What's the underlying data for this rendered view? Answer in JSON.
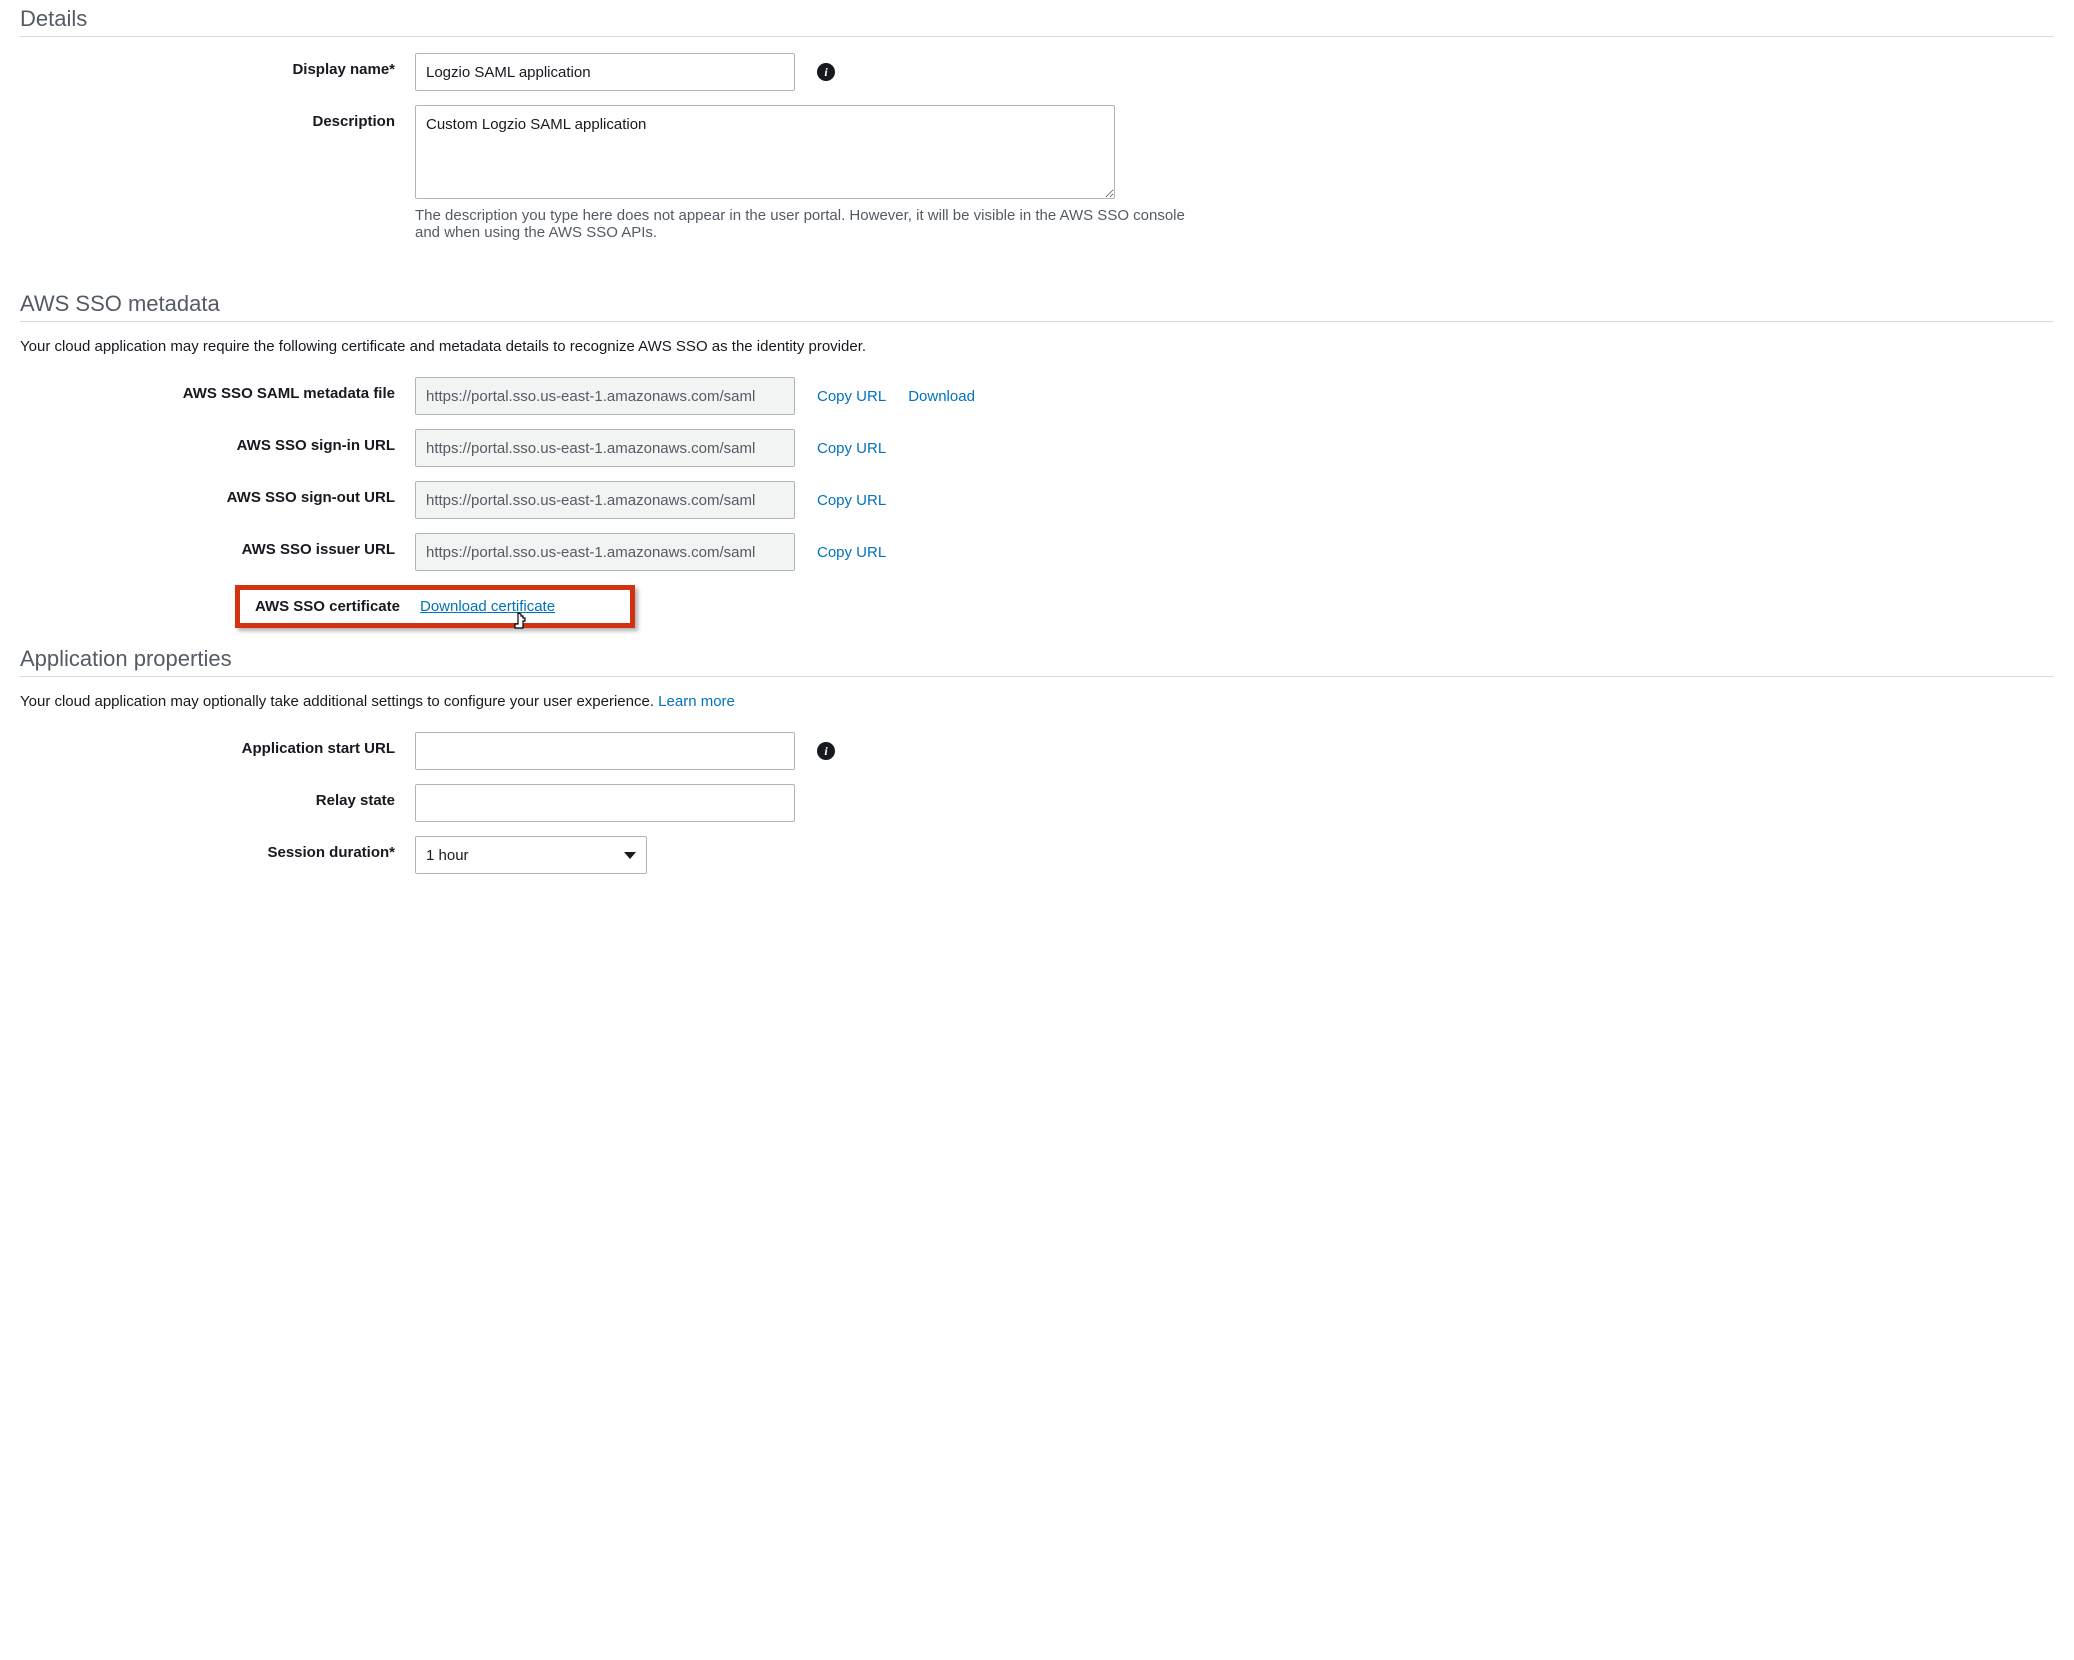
{
  "details": {
    "title": "Details",
    "display_name_label": "Display name*",
    "display_name_value": "Logzio SAML application",
    "desc_label": "Description",
    "desc_value": "Custom Logzio SAML application",
    "desc_hint": "The description you type here does not appear in the user portal. However, it will be visible in the AWS SSO console and when using the AWS SSO APIs."
  },
  "metadata": {
    "title": "AWS SSO metadata",
    "subhead": "Your cloud application may require the following certificate and metadata details to recognize AWS SSO as the identity provider.",
    "rows": [
      {
        "label": "AWS SSO SAML metadata file",
        "value": "https://portal.sso.us-east-1.amazonaws.com/saml",
        "copy": "Copy URL",
        "download": "Download"
      },
      {
        "label": "AWS SSO sign-in URL",
        "value": "https://portal.sso.us-east-1.amazonaws.com/saml",
        "copy": "Copy URL"
      },
      {
        "label": "AWS SSO sign-out URL",
        "value": "https://portal.sso.us-east-1.amazonaws.com/saml",
        "copy": "Copy URL"
      },
      {
        "label": "AWS SSO issuer URL",
        "value": "https://portal.sso.us-east-1.amazonaws.com/saml",
        "copy": "Copy URL"
      }
    ],
    "cert_label": "AWS SSO certificate",
    "cert_link": "Download certificate"
  },
  "props": {
    "title": "Application properties",
    "subhead_prefix": "Your cloud application may optionally take additional settings to configure your user experience. ",
    "learn_more": "Learn more",
    "start_url_label": "Application start URL",
    "start_url_value": "",
    "relay_label": "Relay state",
    "relay_value": "",
    "session_label": "Session duration*",
    "session_value": "1 hour"
  },
  "icons": {
    "info": "i"
  }
}
